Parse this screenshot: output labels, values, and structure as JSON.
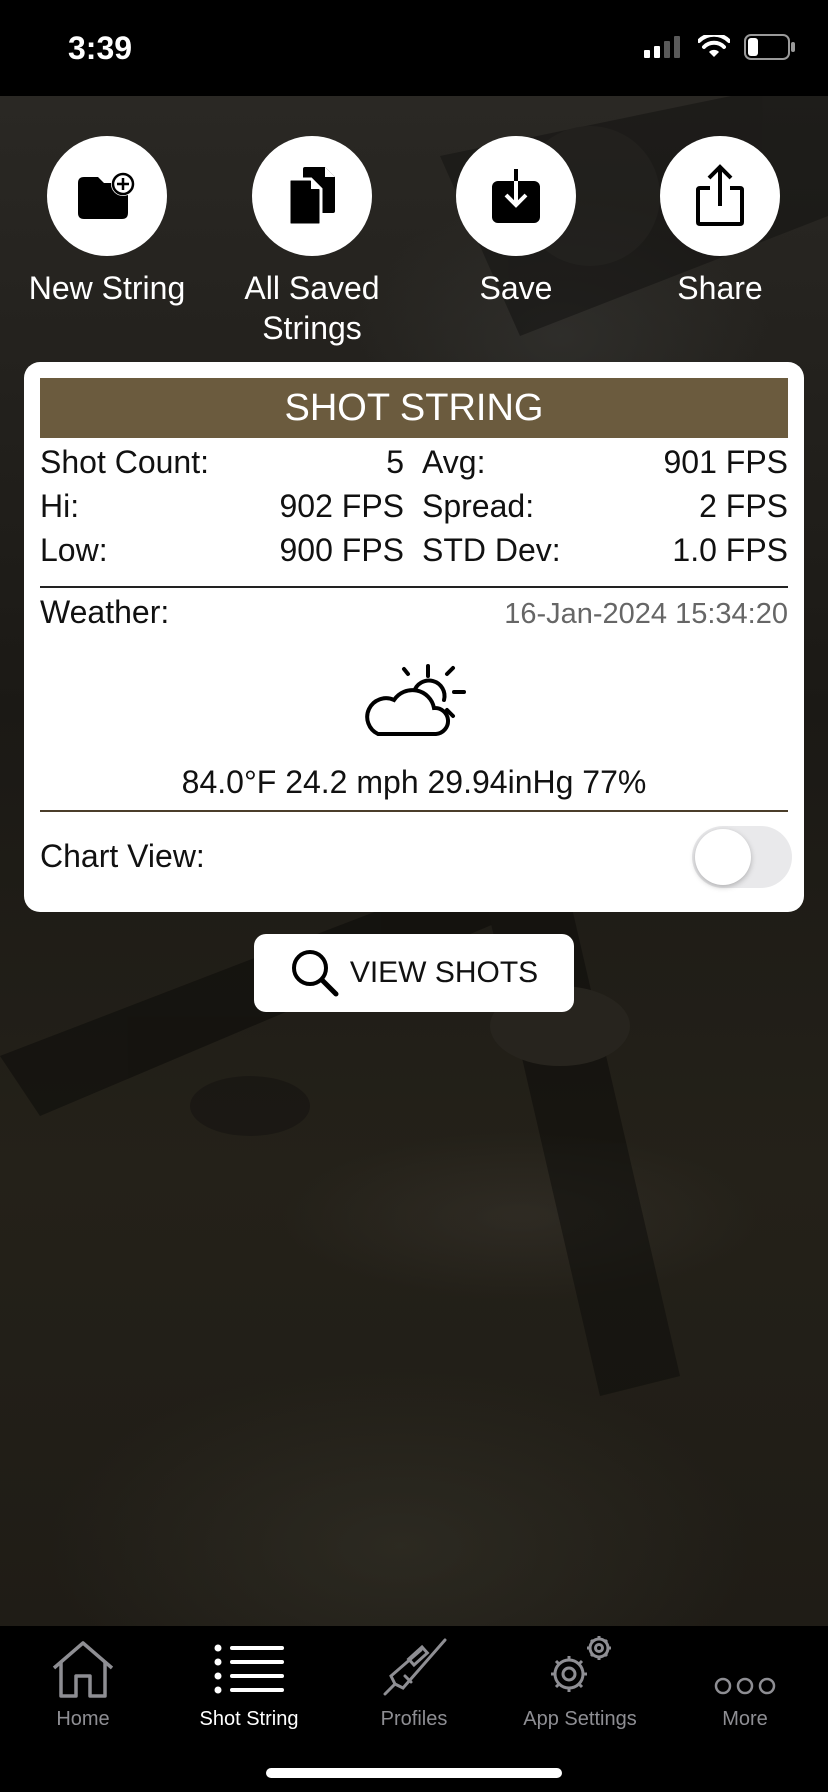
{
  "status_bar": {
    "time": "3:39"
  },
  "actions": [
    {
      "label": "New String",
      "icon": "folder-plus-icon"
    },
    {
      "label": "All Saved Strings",
      "icon": "documents-icon"
    },
    {
      "label": "Save",
      "icon": "download-icon"
    },
    {
      "label": "Share",
      "icon": "share-icon"
    }
  ],
  "shot_string": {
    "title": "SHOT STRING",
    "shot_count_label": "Shot Count:",
    "shot_count_value": "5",
    "avg_label": "Avg:",
    "avg_value": "901 FPS",
    "hi_label": "Hi:",
    "hi_value": "902 FPS",
    "spread_label": "Spread:",
    "spread_value": "2 FPS",
    "low_label": "Low:",
    "low_value": "900 FPS",
    "std_dev_label": "STD Dev:",
    "std_dev_value": "1.0 FPS",
    "weather_label": "Weather:",
    "weather_timestamp": "16-Jan-2024 15:34:20",
    "weather_icon": "partly-cloudy-icon",
    "weather_values": "84.0°F 24.2 mph 29.94inHg 77%",
    "chart_view_label": "Chart View:",
    "chart_view_enabled": false
  },
  "view_shots_label": "VIEW SHOTS",
  "tabbar": [
    {
      "label": "Home",
      "icon": "home-icon",
      "active": false
    },
    {
      "label": "Shot String",
      "icon": "list-icon",
      "active": true
    },
    {
      "label": "Profiles",
      "icon": "rifle-icon",
      "active": false
    },
    {
      "label": "App Settings",
      "icon": "gears-icon",
      "active": false
    },
    {
      "label": "More",
      "icon": "more-icon",
      "active": false
    }
  ],
  "colors": {
    "header_brown": "#6b5b3e",
    "tab_inactive": "#8e8e93",
    "tab_active": "#ffffff"
  }
}
